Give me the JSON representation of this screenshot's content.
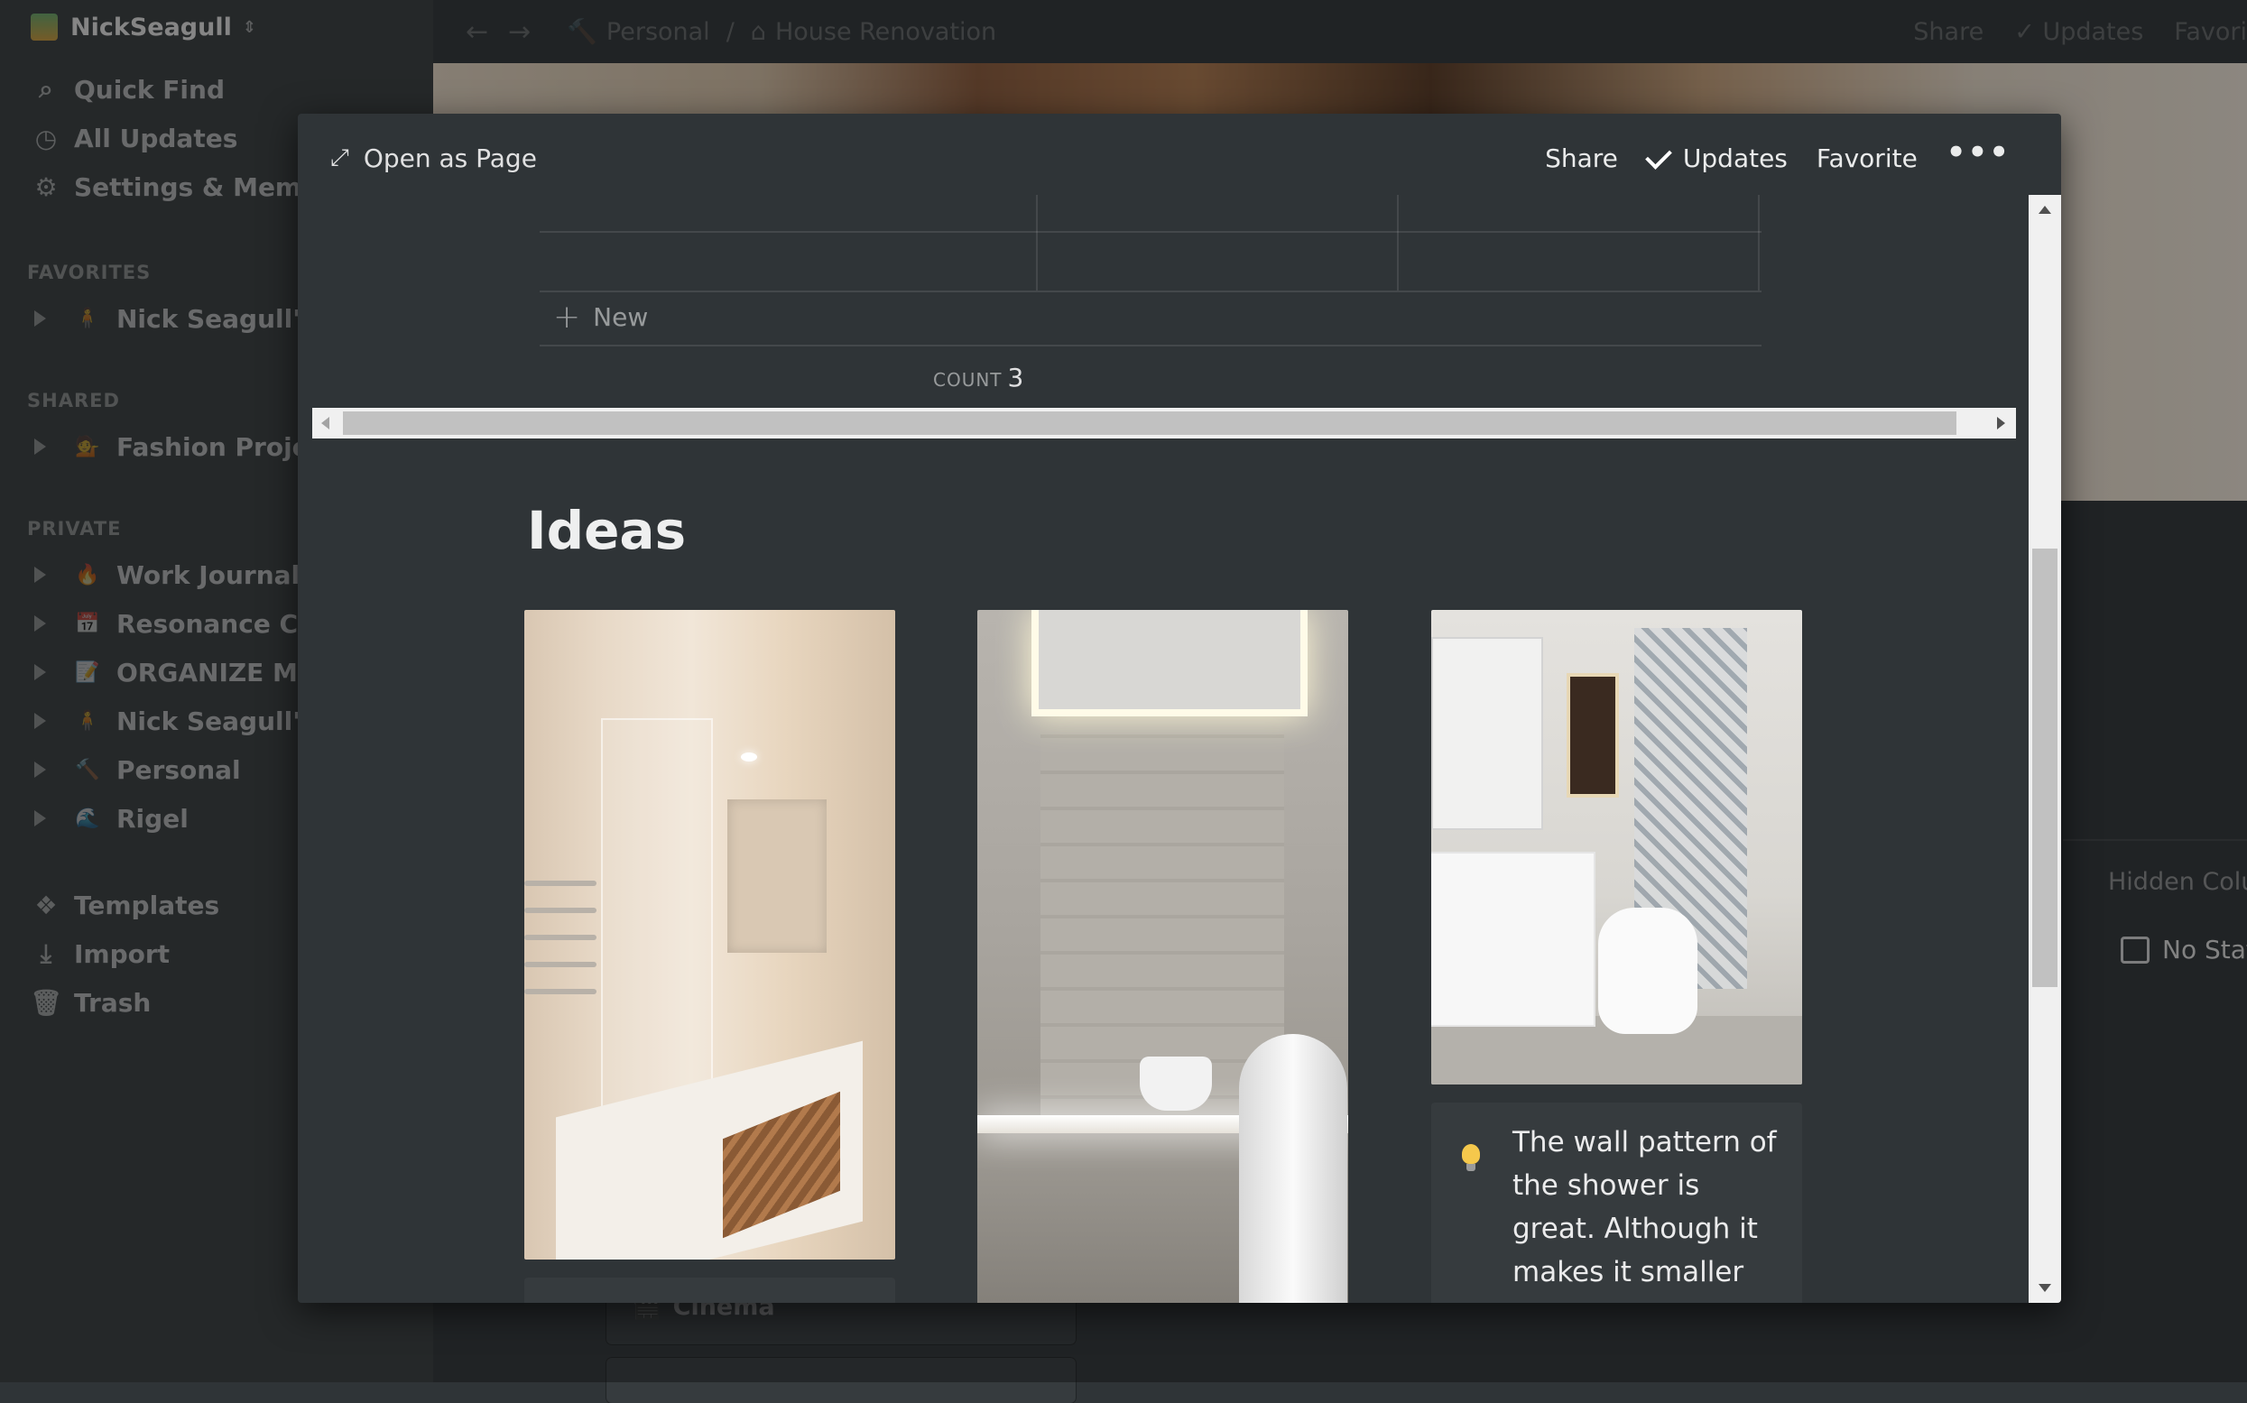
{
  "sidebar": {
    "workspace": "NickSeagull",
    "nav": [
      {
        "label": "Quick Find",
        "icon": "search-icon"
      },
      {
        "label": "All Updates",
        "icon": "clock-icon"
      },
      {
        "label": "Settings & Members",
        "icon": "gear-icon"
      }
    ],
    "favorites_label": "FAVORITES",
    "favorites": [
      {
        "label": "Nick Seagull's Kr",
        "emoji": "🧍"
      }
    ],
    "shared_label": "SHARED",
    "shared": [
      {
        "label": "Fashion Project",
        "emoji": "💁"
      }
    ],
    "private_label": "PRIVATE",
    "private": [
      {
        "label": "Work Journal",
        "emoji": "🔥"
      },
      {
        "label": "Resonance Caler",
        "emoji": "📅"
      },
      {
        "label": "ORGANIZE ME!!",
        "emoji": "📝"
      },
      {
        "label": "Nick Seagull's Kr",
        "emoji": "🧍"
      },
      {
        "label": "Personal",
        "emoji": "🔨"
      },
      {
        "label": "Rigel",
        "emoji": "🌊"
      }
    ],
    "bottom": [
      {
        "label": "Templates",
        "icon": "templates-icon"
      },
      {
        "label": "Import",
        "icon": "import-icon"
      },
      {
        "label": "Trash",
        "icon": "trash-icon"
      }
    ]
  },
  "topbar": {
    "breadcrumb": [
      "Personal",
      "House Renovation"
    ],
    "share": "Share",
    "updates": "Updates",
    "favorite": "Favori"
  },
  "behind": {
    "hidden_columns": "Hidden Colu",
    "no_status": "No Statu",
    "cinema": "Cinema"
  },
  "modal": {
    "open_as_page": "Open as Page",
    "share": "Share",
    "updates": "Updates",
    "favorite": "Favorite",
    "more": "•••",
    "new_label": "New",
    "count_label": "COUNT",
    "count_value": "3",
    "section_title": "Ideas",
    "caption": "The wall pattern of the shower is great. Although it makes it smaller"
  }
}
